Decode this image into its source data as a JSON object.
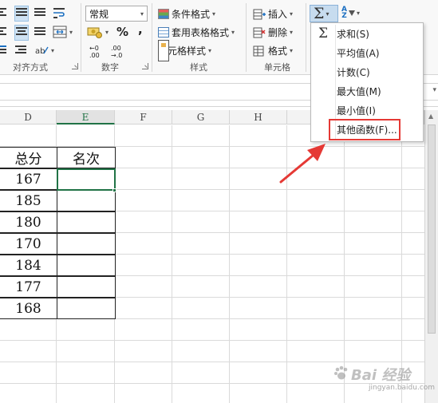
{
  "ribbon": {
    "alignment_group_label": "对齐方式",
    "number_group_label": "数字",
    "styles_group_label": "样式",
    "cells_group_label": "单元格",
    "number_format_value": "常规",
    "percent_symbol": "%",
    "comma_symbol": ",",
    "inc_decimal_top": "←0",
    "inc_decimal_bottom": ".00",
    "dec_decimal_top": ".00",
    "dec_decimal_bottom": "→.0",
    "conditional_format_label": "条件格式",
    "format_as_table_label": "套用表格格式",
    "cell_styles_label": "单元格样式",
    "insert_label": "插入",
    "delete_label": "删除",
    "format_label": "格式",
    "sort_az_top": "A",
    "sort_az_bottom": "Z"
  },
  "columns": [
    "D",
    "E",
    "F",
    "G",
    "H"
  ],
  "selected_column": "E",
  "table": {
    "headers": [
      "总分",
      "名次"
    ],
    "scores": [
      "167",
      "185",
      "180",
      "170",
      "184",
      "177",
      "168"
    ],
    "ranks": [
      "",
      "",
      "",
      "",
      "",
      "",
      ""
    ]
  },
  "autosum_menu": {
    "items": [
      {
        "icon": "Σ",
        "label": "求和(S)"
      },
      {
        "icon": "",
        "label": "平均值(A)"
      },
      {
        "icon": "",
        "label": "计数(C)"
      },
      {
        "icon": "",
        "label": "最大值(M)"
      },
      {
        "icon": "",
        "label": "最小值(I)"
      },
      {
        "icon": "",
        "label": "其他函数(F)..."
      }
    ],
    "highlighted_item": "其他函数(F)..."
  },
  "colors": {
    "excel_green": "#217346",
    "highlight_red": "#e53935",
    "selected_button_bg": "#c7dcef"
  },
  "watermark": {
    "main": "Bai 经验",
    "sub": "jingyan.baidu.com"
  }
}
